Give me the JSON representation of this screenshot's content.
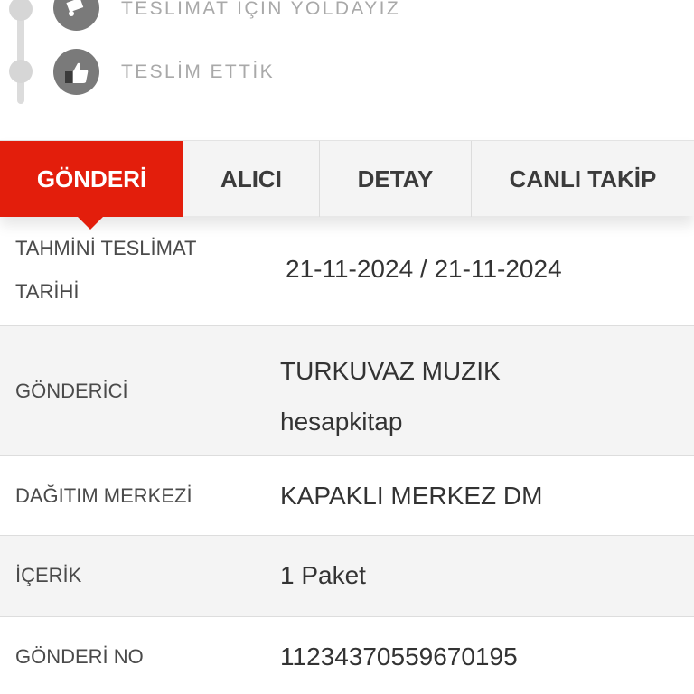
{
  "timeline": {
    "steps": [
      {
        "label": "TESLİMAT İÇİN YOLDAYIZ",
        "icon": "truck-icon"
      },
      {
        "label": "TESLİM ETTİK",
        "icon": "thumbs-up-icon"
      }
    ]
  },
  "tabs": [
    {
      "label": "GÖNDERİ",
      "active": true
    },
    {
      "label": "ALICI",
      "active": false
    },
    {
      "label": "DETAY",
      "active": false
    },
    {
      "label": "CANLI TAKİP",
      "active": false
    }
  ],
  "details": {
    "estimated_delivery": {
      "label": "TAHMİNİ TESLİMAT TARİHİ",
      "value": "21-11-2024 / 21-11-2024"
    },
    "sender": {
      "label": "GÖNDERİCİ",
      "value_line1": "TURKUVAZ MUZIK",
      "value_line2": "hesapkitap"
    },
    "distribution_center": {
      "label": "DAĞITIM MERKEZİ",
      "value": "KAPAKLI MERKEZ DM"
    },
    "content": {
      "label": "İÇERİK",
      "value": "1 Paket"
    },
    "shipment_no": {
      "label": "GÖNDERİ NO",
      "value": "11234370559670195"
    }
  },
  "colors": {
    "accent": "#e31e0c",
    "tab_bg": "#f4f4f4",
    "muted_text": "#a9a9a9",
    "icon_bg": "#7a7a7a"
  }
}
